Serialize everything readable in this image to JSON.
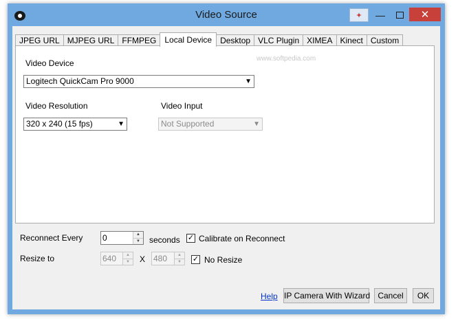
{
  "window": {
    "title": "Video Source",
    "minimize_glyph": "—",
    "close_glyph": "✕",
    "extra_glyph": "✦"
  },
  "tabs": [
    {
      "label": "JPEG URL",
      "active": false
    },
    {
      "label": "MJPEG URL",
      "active": false
    },
    {
      "label": "FFMPEG",
      "active": false
    },
    {
      "label": "Local Device",
      "active": true
    },
    {
      "label": "Desktop",
      "active": false
    },
    {
      "label": "VLC Plugin",
      "active": false
    },
    {
      "label": "XIMEA",
      "active": false
    },
    {
      "label": "Kinect",
      "active": false
    },
    {
      "label": "Custom",
      "active": false
    }
  ],
  "local_device": {
    "video_device_label": "Video Device",
    "video_device_value": "Logitech QuickCam Pro 9000",
    "video_resolution_label": "Video Resolution",
    "video_resolution_value": "320 x 240 (15 fps)",
    "video_input_label": "Video Input",
    "video_input_value": "Not Supported",
    "watermark": "www.softpedia.com"
  },
  "reconnect": {
    "label": "Reconnect Every",
    "value": "0",
    "unit": "seconds",
    "calibrate_label": "Calibrate on Reconnect",
    "calibrate_checked": true
  },
  "resize": {
    "label": "Resize to",
    "width": "640",
    "separator": "X",
    "height": "480",
    "no_resize_label": "No Resize",
    "no_resize_checked": true
  },
  "footer": {
    "help_label": "Help",
    "wizard_label": "IP Camera With Wizard",
    "cancel_label": "Cancel",
    "ok_label": "OK"
  },
  "icons": {
    "app": "eye-icon",
    "dropdown": "chevron-down-icon",
    "spin_up": "spin-up-icon",
    "spin_down": "spin-down-icon",
    "check": "checkmark-icon"
  },
  "colors": {
    "title_bar": "#6fa9e0",
    "close_button": "#c7403a",
    "link": "#0033cc"
  }
}
